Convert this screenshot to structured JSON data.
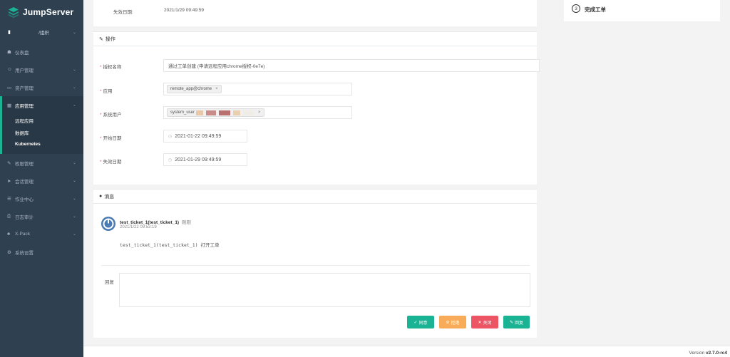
{
  "brand": {
    "name": "JumpServer"
  },
  "sidebar": {
    "org_label": "/组织",
    "items": [
      {
        "icon": "dashboard-icon",
        "glyph": "☗",
        "label": "仪表盘",
        "has_children": false
      },
      {
        "icon": "users-icon",
        "glyph": "☺",
        "label": "用户管理",
        "has_children": true
      },
      {
        "icon": "assets-icon",
        "glyph": "▭",
        "label": "资产管理",
        "has_children": true
      },
      {
        "icon": "apps-icon",
        "glyph": "▦",
        "label": "应用管理",
        "has_children": true
      },
      {
        "icon": "perms-icon",
        "glyph": "✎",
        "label": "权限管理",
        "has_children": true
      },
      {
        "icon": "sessions-icon",
        "glyph": "➤",
        "label": "会话管理",
        "has_children": true
      },
      {
        "icon": "ops-icon",
        "glyph": "☰",
        "label": "作业中心",
        "has_children": true
      },
      {
        "icon": "audit-icon",
        "glyph": "⎙",
        "label": "日志审计",
        "has_children": true
      },
      {
        "icon": "xpack-icon",
        "glyph": "♣",
        "label": "X-Pack",
        "has_children": true
      },
      {
        "icon": "settings-icon",
        "glyph": "⚙",
        "label": "系统设置",
        "has_children": false
      }
    ],
    "sub_items": [
      "远程应用",
      "数据库",
      "Kubernetes"
    ]
  },
  "top_panel": {
    "expire_label": "失效日期:",
    "expire_value": "2021/1/29 09:49:59"
  },
  "steps": {
    "number": "3",
    "label": "完成工单"
  },
  "ops_panel": {
    "title": "操作",
    "fields": {
      "auth_name": {
        "label": "授权名称",
        "value": "通过工单创建 (申请远程应用chrome授权-0e7e)"
      },
      "application": {
        "label": "应用",
        "tag": "remote_app@chrome"
      },
      "system_user": {
        "label": "系统用户",
        "tag": "system_user"
      },
      "start_date": {
        "label": "开始日期",
        "value": "2021-01-22 09:49:59"
      },
      "expire_date": {
        "label": "失效日期",
        "value": "2021-01-29 09:49:59"
      }
    }
  },
  "messages_panel": {
    "title": "消息",
    "author": "test_ticket_1(test_ticket_1)",
    "author_suffix": "刚刚",
    "time": "2021/1/22 09:53:19",
    "body": "test_ticket_1(test_ticket_1) 打开工单",
    "reply_label": "回复",
    "buttons": {
      "approve": {
        "label": "同意",
        "color": "#1ab394"
      },
      "reject": {
        "label": "拒绝",
        "color": "#f8ac59"
      },
      "close": {
        "label": "关闭",
        "color": "#ed5565"
      },
      "reply": {
        "label": "回复",
        "color": "#1ab394"
      }
    }
  },
  "footer": {
    "prefix": "Version",
    "version": "v2.7.0-rc4"
  }
}
